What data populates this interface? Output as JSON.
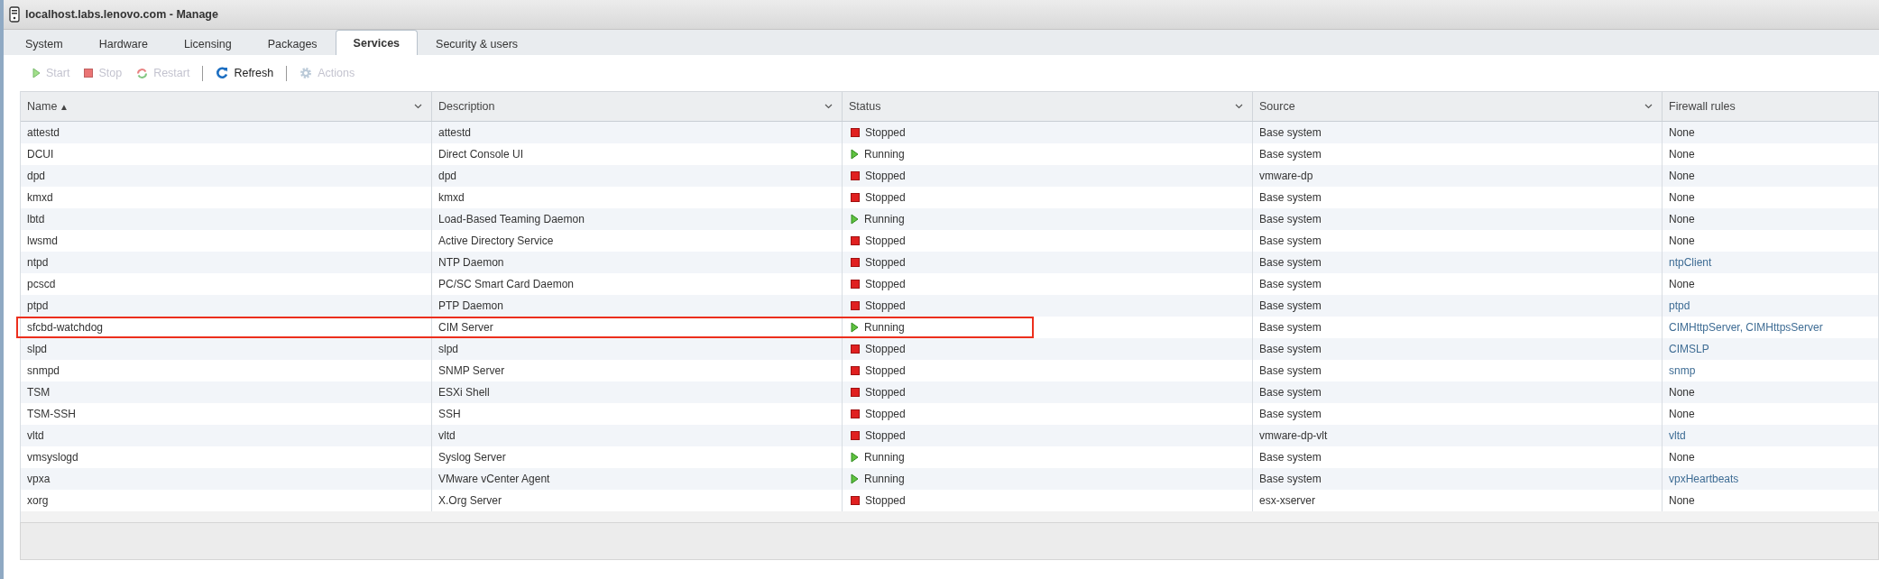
{
  "window": {
    "title": "localhost.labs.lenovo.com - Manage"
  },
  "tabs": [
    {
      "label": "System",
      "selected": false
    },
    {
      "label": "Hardware",
      "selected": false
    },
    {
      "label": "Licensing",
      "selected": false
    },
    {
      "label": "Packages",
      "selected": false
    },
    {
      "label": "Services",
      "selected": true
    },
    {
      "label": "Security & users",
      "selected": false
    }
  ],
  "toolbar": [
    {
      "kind": "start",
      "label": "Start",
      "disabled": true
    },
    {
      "kind": "stop",
      "label": "Stop",
      "disabled": true
    },
    {
      "kind": "restart",
      "label": "Restart",
      "disabled": true
    },
    {
      "kind": "separator"
    },
    {
      "kind": "refresh",
      "label": "Refresh",
      "disabled": false
    },
    {
      "kind": "separator"
    },
    {
      "kind": "actions",
      "label": "Actions",
      "disabled": true
    }
  ],
  "table": {
    "columns": [
      {
        "label": "Name",
        "sort_mark": "▲",
        "menu": true
      },
      {
        "label": "Description",
        "menu": true
      },
      {
        "label": "Status",
        "menu": true
      },
      {
        "label": "Source",
        "menu": true
      },
      {
        "label": "Firewall rules",
        "menu": false
      }
    ],
    "rows": [
      {
        "name": "attestd",
        "description": "attestd",
        "status": "Stopped",
        "running": false,
        "source": "Base system",
        "firewall": "None",
        "firewall_link": false,
        "highlighted": false
      },
      {
        "name": "DCUI",
        "description": "Direct Console UI",
        "status": "Running",
        "running": true,
        "source": "Base system",
        "firewall": "None",
        "firewall_link": false,
        "highlighted": false
      },
      {
        "name": "dpd",
        "description": "dpd",
        "status": "Stopped",
        "running": false,
        "source": "vmware-dp",
        "firewall": "None",
        "firewall_link": false,
        "highlighted": false
      },
      {
        "name": "kmxd",
        "description": "kmxd",
        "status": "Stopped",
        "running": false,
        "source": "Base system",
        "firewall": "None",
        "firewall_link": false,
        "highlighted": false
      },
      {
        "name": "lbtd",
        "description": "Load-Based Teaming Daemon",
        "status": "Running",
        "running": true,
        "source": "Base system",
        "firewall": "None",
        "firewall_link": false,
        "highlighted": false
      },
      {
        "name": "lwsmd",
        "description": "Active Directory Service",
        "status": "Stopped",
        "running": false,
        "source": "Base system",
        "firewall": "None",
        "firewall_link": false,
        "highlighted": false
      },
      {
        "name": "ntpd",
        "description": "NTP Daemon",
        "status": "Stopped",
        "running": false,
        "source": "Base system",
        "firewall": "ntpClient",
        "firewall_link": true,
        "highlighted": false
      },
      {
        "name": "pcscd",
        "description": "PC/SC Smart Card Daemon",
        "status": "Stopped",
        "running": false,
        "source": "Base system",
        "firewall": "None",
        "firewall_link": false,
        "highlighted": false
      },
      {
        "name": "ptpd",
        "description": "PTP Daemon",
        "status": "Stopped",
        "running": false,
        "source": "Base system",
        "firewall": "ptpd",
        "firewall_link": true,
        "highlighted": false
      },
      {
        "name": "sfcbd-watchdog",
        "description": "CIM Server",
        "status": "Running",
        "running": true,
        "source": "Base system",
        "firewall": "CIMHttpServer, CIMHttpsServer",
        "firewall_link": true,
        "highlighted": true
      },
      {
        "name": "slpd",
        "description": "slpd",
        "status": "Stopped",
        "running": false,
        "source": "Base system",
        "firewall": "CIMSLP",
        "firewall_link": true,
        "highlighted": false
      },
      {
        "name": "snmpd",
        "description": "SNMP Server",
        "status": "Stopped",
        "running": false,
        "source": "Base system",
        "firewall": "snmp",
        "firewall_link": true,
        "highlighted": false
      },
      {
        "name": "TSM",
        "description": "ESXi Shell",
        "status": "Stopped",
        "running": false,
        "source": "Base system",
        "firewall": "None",
        "firewall_link": false,
        "highlighted": false
      },
      {
        "name": "TSM-SSH",
        "description": "SSH",
        "status": "Stopped",
        "running": false,
        "source": "Base system",
        "firewall": "None",
        "firewall_link": false,
        "highlighted": false
      },
      {
        "name": "vltd",
        "description": "vltd",
        "status": "Stopped",
        "running": false,
        "source": "vmware-dp-vlt",
        "firewall": "vltd",
        "firewall_link": true,
        "highlighted": false
      },
      {
        "name": "vmsyslogd",
        "description": "Syslog Server",
        "status": "Running",
        "running": true,
        "source": "Base system",
        "firewall": "None",
        "firewall_link": false,
        "highlighted": false
      },
      {
        "name": "vpxa",
        "description": "VMware vCenter Agent",
        "status": "Running",
        "running": true,
        "source": "Base system",
        "firewall": "vpxHeartbeats",
        "firewall_link": true,
        "highlighted": false
      },
      {
        "name": "xorg",
        "description": "X.Org Server",
        "status": "Stopped",
        "running": false,
        "source": "esx-xserver",
        "firewall": "None",
        "firewall_link": false,
        "highlighted": false
      }
    ]
  }
}
